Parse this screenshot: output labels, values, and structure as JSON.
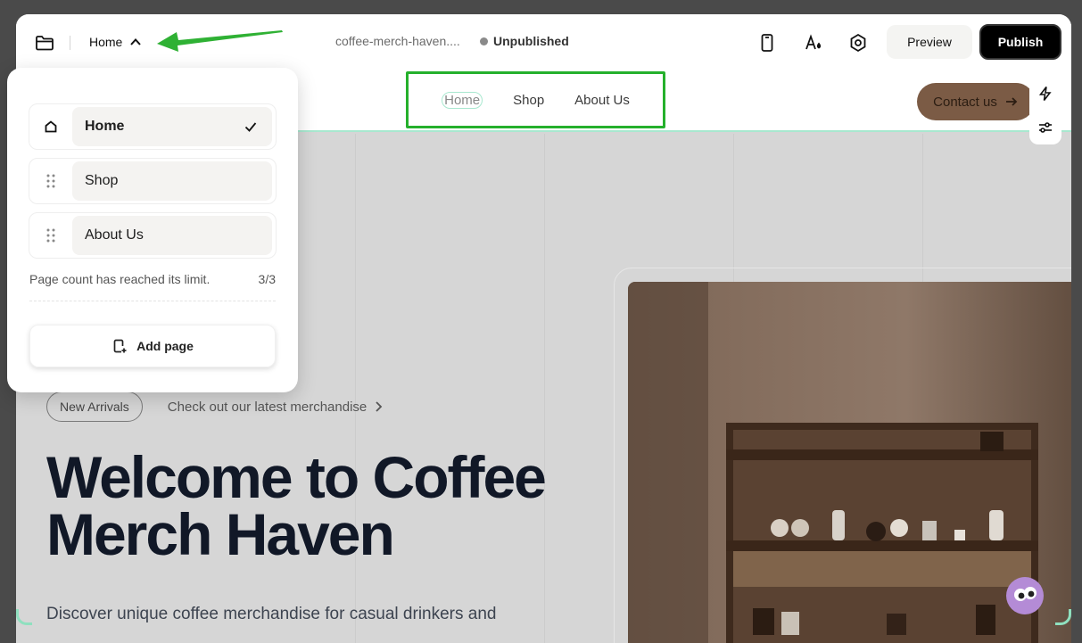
{
  "toolbar": {
    "current_page": "Home",
    "site_name": "coffee-merch-haven....",
    "status": "Unpublished",
    "preview_label": "Preview",
    "publish_label": "Publish"
  },
  "site": {
    "nav": [
      "Home",
      "Shop",
      "About Us"
    ],
    "contact_label": "Contact us",
    "badge": "New Arrivals",
    "merch_link": "Check out our latest merchandise",
    "hero_title": "Welcome to Coffee Merch Haven",
    "hero_desc": "Discover unique coffee merchandise for casual drinkers and"
  },
  "pages_panel": {
    "items": [
      {
        "label": "Home",
        "selected": true
      },
      {
        "label": "Shop",
        "selected": false
      },
      {
        "label": "About Us",
        "selected": false
      }
    ],
    "limit_text": "Page count has reached its limit.",
    "count": "3/3",
    "add_label": "Add page"
  },
  "colors": {
    "highlight_green": "#25b02c",
    "accent_mint": "#a8e8cf",
    "contact_brown": "#7b5b45",
    "publish_black": "#000000"
  }
}
